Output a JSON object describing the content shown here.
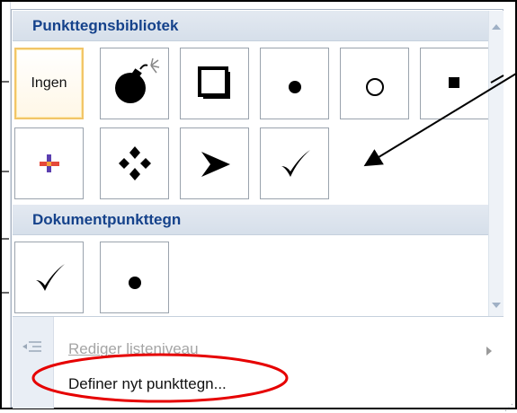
{
  "sections": {
    "library_title": "Punkttegnsbibliotek",
    "document_title": "Dokumentpunkttegn"
  },
  "library_items": [
    {
      "id": "none",
      "label": "Ingen",
      "icon": "none-text",
      "selected": true
    },
    {
      "id": "bomb",
      "icon": "bomb-icon"
    },
    {
      "id": "shadow-square",
      "icon": "shadow-square-icon"
    },
    {
      "id": "dot",
      "icon": "dot-icon"
    },
    {
      "id": "circle",
      "icon": "circle-outline-icon"
    },
    {
      "id": "square",
      "icon": "filled-square-icon"
    },
    {
      "id": "colored-cross",
      "icon": "colored-cross-icon"
    },
    {
      "id": "four-diamonds",
      "icon": "four-diamonds-icon"
    },
    {
      "id": "arrowhead",
      "icon": "arrowhead-icon"
    },
    {
      "id": "checkmark",
      "icon": "checkmark-icon"
    }
  ],
  "document_items": [
    {
      "id": "doc-checkmark",
      "icon": "checkmark-icon"
    },
    {
      "id": "doc-dot",
      "icon": "dot-icon"
    }
  ],
  "menu": {
    "edit_level_label": "Rediger listeniveau",
    "define_new_label": "Definer nyt punkttegn..."
  },
  "colors": {
    "header_text": "#15428b",
    "selection_border": "#f2c568",
    "annotation_red": "#e60000"
  }
}
